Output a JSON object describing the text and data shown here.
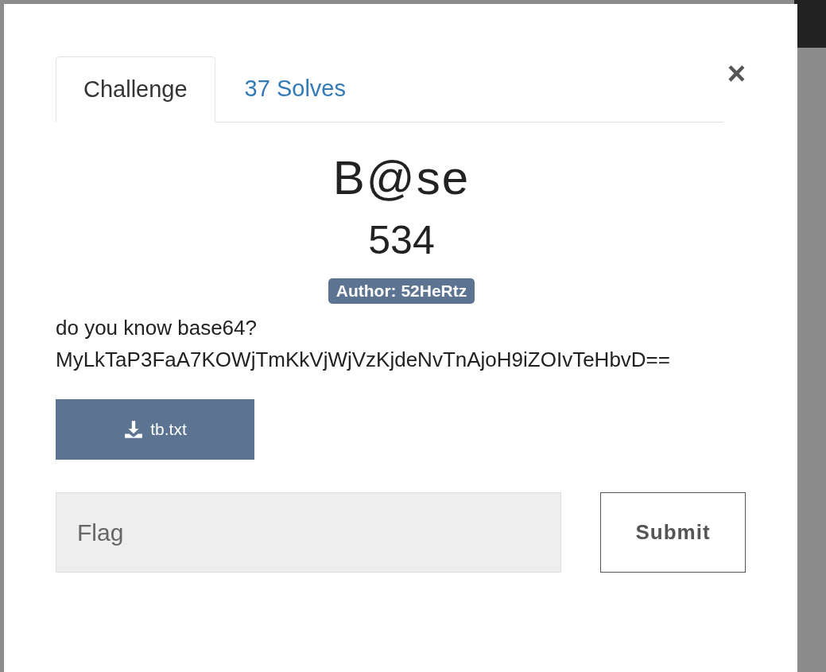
{
  "tabs": [
    {
      "label": "Challenge",
      "selected": true
    },
    {
      "label": "37 Solves",
      "selected": false
    }
  ],
  "close": "×",
  "challenge": {
    "name": "B@se",
    "points": "534",
    "author": "Author: 52HeRtz",
    "description": [
      "do you know base64?",
      "MyLkTaP3FaA7KOWjTmKkVjWjVzKjdeNvTnAjoH9iZOIvTeHbvD=="
    ]
  },
  "file": "tb.txt",
  "flag": {
    "placeholder": "Flag"
  },
  "submit": "Submit"
}
